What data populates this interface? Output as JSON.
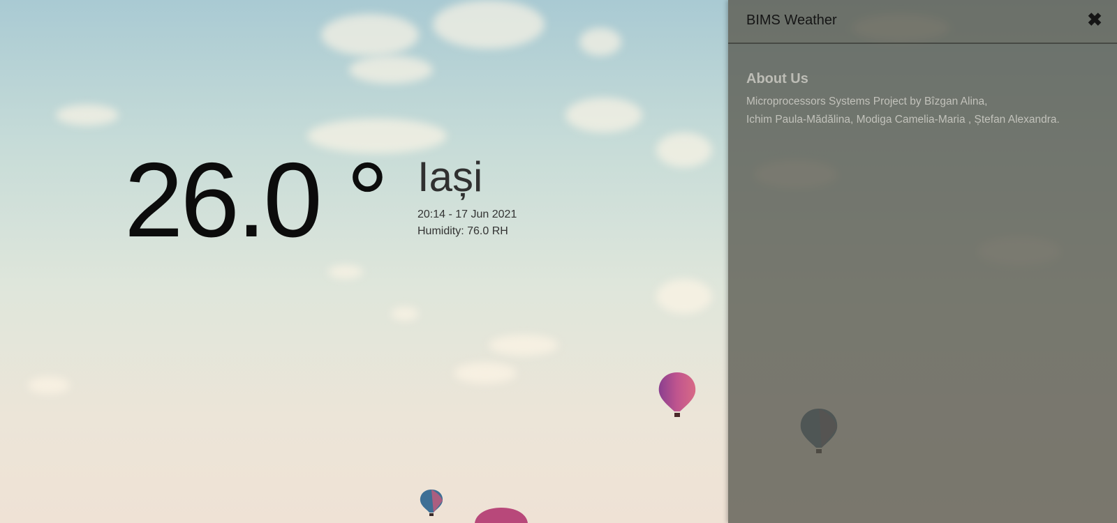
{
  "weather": {
    "temperature": "26.0 °",
    "city": "Iași",
    "datetime": "20:14 - 17 Jun 2021",
    "humidity": "Humidity: 76.0 RH"
  },
  "sidebar": {
    "brand": "BIMS Weather",
    "close_icon": "close-icon",
    "about_title": "About Us",
    "about_line_1": "Microprocessors Systems Project by Bîzgan Alina,",
    "about_line_2": "Ichim Paula-Mădălina, Modiga Camelia-Maria , Ștefan Alexandra."
  },
  "colors": {
    "temperature_text": "#0c0c0c",
    "city_text": "#303030",
    "sidebar_overlay": "#585850"
  }
}
